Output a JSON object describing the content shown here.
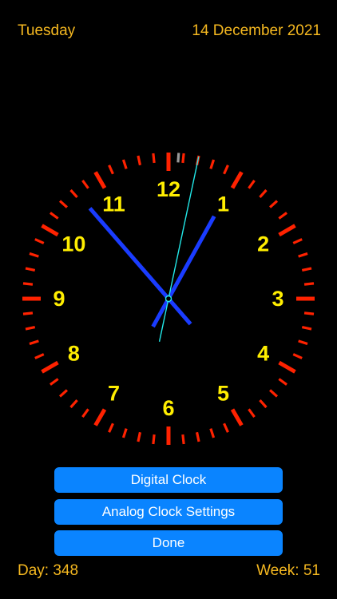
{
  "header": {
    "weekday": "Tuesday",
    "date": "14 December 2021"
  },
  "clock": {
    "numerals": [
      "12",
      "1",
      "2",
      "3",
      "4",
      "5",
      "6",
      "7",
      "8",
      "9",
      "10",
      "11"
    ],
    "time": {
      "hours": 12,
      "minutes": 54,
      "seconds": 1.5
    },
    "colors": {
      "face": "#000000",
      "ticks": "#ff2200",
      "numerals": "#ffee00",
      "hands": "#1a3cff",
      "second_hand": "#22e8e8",
      "top_marker": "#999999"
    }
  },
  "buttons": {
    "digital_clock": "Digital Clock",
    "analog_settings": "Analog Clock Settings",
    "done": "Done"
  },
  "footer": {
    "day": "Day: 348",
    "week": "Week: 51"
  }
}
